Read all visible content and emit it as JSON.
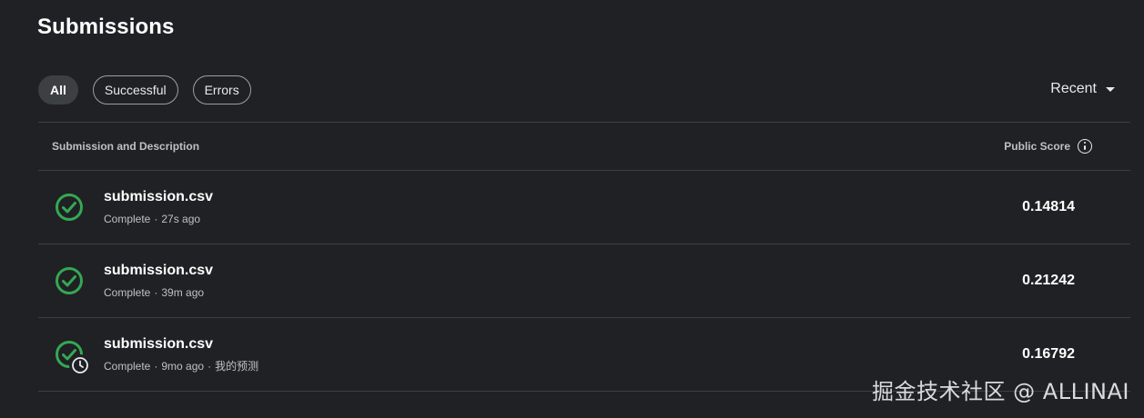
{
  "page": {
    "title": "Submissions"
  },
  "filters": [
    {
      "label": "All",
      "active": true
    },
    {
      "label": "Successful",
      "active": false
    },
    {
      "label": "Errors",
      "active": false
    }
  ],
  "sort": {
    "label": "Recent",
    "icon": "caret-down-icon"
  },
  "table": {
    "columns": {
      "description": "Submission and Description",
      "score": "Public Score",
      "score_icon": "info-icon"
    },
    "rows": [
      {
        "file": "submission.csv",
        "status": "Complete",
        "time": "27s ago",
        "description": "",
        "score": "0.14814",
        "icon": "check-circle-icon"
      },
      {
        "file": "submission.csv",
        "status": "Complete",
        "time": "39m ago",
        "description": "",
        "score": "0.21242",
        "icon": "check-circle-icon"
      },
      {
        "file": "submission.csv",
        "status": "Complete",
        "time": "9mo ago",
        "description": "我的预测",
        "score": "0.16792",
        "icon": "check-circle-clock-icon"
      }
    ]
  },
  "watermark": "掘金技术社区 @ ALLINAI",
  "colors": {
    "background": "#202124",
    "success": "#34a853",
    "divider": "#3c4043",
    "chip_active": "#3c4043"
  }
}
